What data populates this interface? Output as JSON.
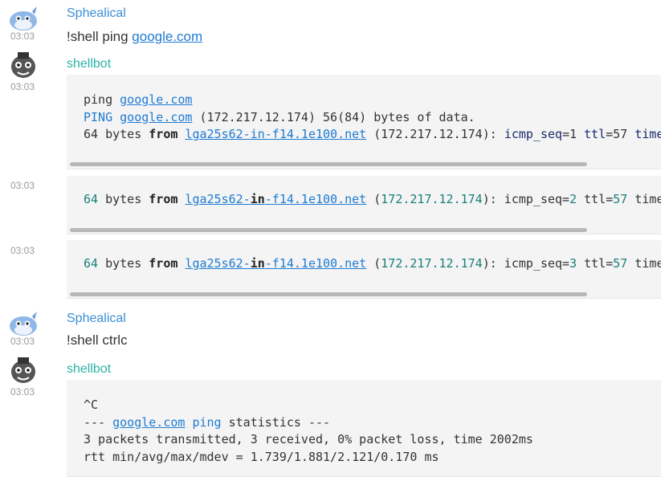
{
  "messages": [
    {
      "time": "03:03",
      "user": "Sphealical",
      "text_prefix": "!shell ping ",
      "text_link": "google.com"
    },
    {
      "time": "03:03",
      "user": "shellbot",
      "lines": [
        {
          "a": "ping ",
          "link": "google.com"
        },
        {
          "a": "PING ",
          "link": "google.com",
          "b": " (172.217.12.174) 56(84) bytes of data."
        },
        {
          "a": "64 bytes ",
          "kw": "from",
          "sp": " ",
          "link": "lga25s62-in-f14.1e100.net",
          "b": " (172.217.12.174): ",
          "c": "icmp_seq",
          "d": "=1 ",
          "e": "ttl",
          "f": "=57 ",
          "g": "time"
        }
      ]
    },
    {
      "time": "03:03",
      "line": {
        "n1": "64",
        "a": " bytes ",
        "kw": "from",
        "sp": " ",
        "l1": "lga25s62-",
        "l2": "in",
        "l3": "-f14.1e100.net",
        "b": " (",
        "ip": "172.217.12.174",
        "c": "): icmp_seq=",
        "seq": "2",
        "d": " ttl=",
        "ttl": "57",
        "e": " time"
      }
    },
    {
      "time": "03:03",
      "line": {
        "n1": "64",
        "a": " bytes ",
        "kw": "from",
        "sp": " ",
        "l1": "lga25s62-",
        "l2": "in",
        "l3": "-f14.1e100.net",
        "b": " (",
        "ip": "172.217.12.174",
        "c": "): icmp_seq=",
        "seq": "3",
        "d": " ttl=",
        "ttl": "57",
        "e": " time"
      }
    },
    {
      "time": "03:03",
      "user": "Sphealical",
      "text": "!shell ctrlc"
    },
    {
      "time": "03:03",
      "user": "shellbot",
      "lines": [
        {
          "a": "^C"
        },
        {
          "a": "--- ",
          "link": "google.com",
          "sp": " ",
          "kw2": "ping",
          "b": " statistics ---"
        },
        {
          "a": "3 packets transmitted, 3 received, 0% packet loss, time 2002ms"
        },
        {
          "a": "rtt min/avg/max/mdev = 1.739/1.881/2.121/0.170 ms"
        }
      ]
    }
  ]
}
